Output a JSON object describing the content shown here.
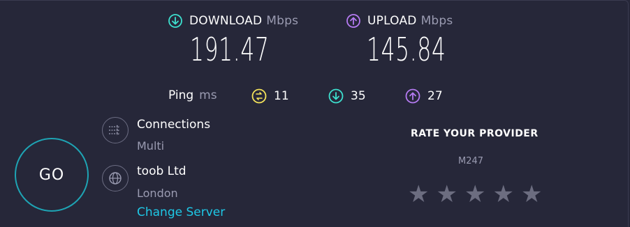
{
  "download": {
    "label": "DOWNLOAD",
    "unit": "Mbps",
    "value": "191.47",
    "color": "#3de0cf"
  },
  "upload": {
    "label": "UPLOAD",
    "unit": "Mbps",
    "value": "145.84",
    "color": "#b57bf2"
  },
  "ping": {
    "label": "Ping",
    "unit": "ms",
    "idle": "11",
    "download": "35",
    "upload": "27",
    "idle_color": "#f5e35a"
  },
  "connections": {
    "title": "Connections",
    "value": "Multi"
  },
  "server": {
    "name": "toob Ltd",
    "location": "London",
    "change_label": "Change Server"
  },
  "go_label": "GO",
  "rating": {
    "title": "RATE YOUR PROVIDER",
    "isp": "M247",
    "stars": 0,
    "max_stars": 5
  },
  "colors": {
    "background": "#262739",
    "accent": "#1ec8e6",
    "go_ring": "#1ea4b4"
  }
}
